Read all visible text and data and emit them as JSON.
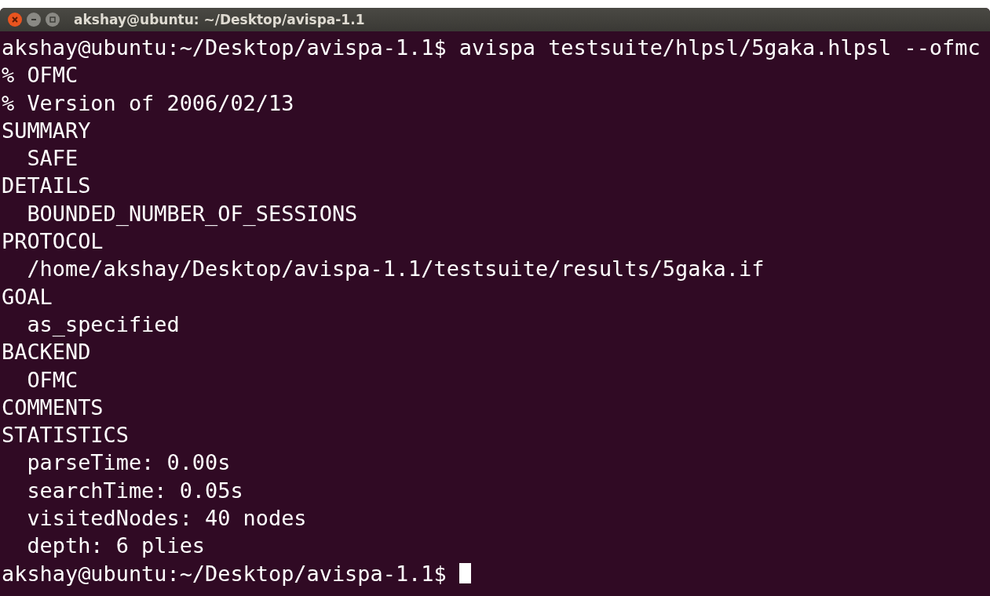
{
  "window": {
    "title": "akshay@ubuntu: ~/Desktop/avispa-1.1"
  },
  "terminal": {
    "lines": [
      {
        "text": "akshay@ubuntu:~/Desktop/avispa-1.1$ avispa testsuite/hlpsl/5gaka.hlpsl --ofmc",
        "cursor": false
      },
      {
        "text": "% OFMC",
        "cursor": false
      },
      {
        "text": "% Version of 2006/02/13",
        "cursor": false
      },
      {
        "text": "SUMMARY",
        "cursor": false
      },
      {
        "text": "  SAFE",
        "cursor": false
      },
      {
        "text": "DETAILS",
        "cursor": false
      },
      {
        "text": "  BOUNDED_NUMBER_OF_SESSIONS",
        "cursor": false
      },
      {
        "text": "PROTOCOL",
        "cursor": false
      },
      {
        "text": "  /home/akshay/Desktop/avispa-1.1/testsuite/results/5gaka.if",
        "cursor": false
      },
      {
        "text": "GOAL",
        "cursor": false
      },
      {
        "text": "  as_specified",
        "cursor": false
      },
      {
        "text": "BACKEND",
        "cursor": false
      },
      {
        "text": "  OFMC",
        "cursor": false
      },
      {
        "text": "COMMENTS",
        "cursor": false
      },
      {
        "text": "STATISTICS",
        "cursor": false
      },
      {
        "text": "  parseTime: 0.00s",
        "cursor": false
      },
      {
        "text": "  searchTime: 0.05s",
        "cursor": false
      },
      {
        "text": "  visitedNodes: 40 nodes",
        "cursor": false
      },
      {
        "text": "  depth: 6 plies",
        "cursor": false
      },
      {
        "text": "akshay@ubuntu:~/Desktop/avispa-1.1$ ",
        "cursor": true
      }
    ]
  }
}
